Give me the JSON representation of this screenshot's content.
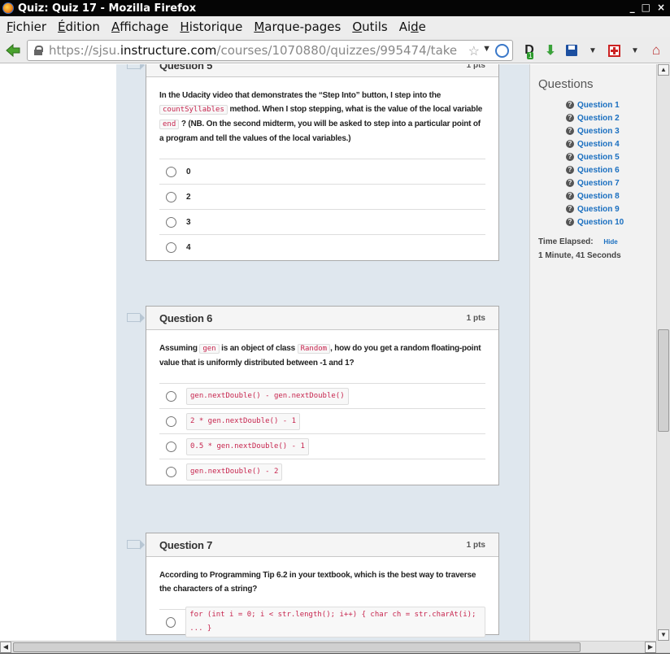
{
  "window": {
    "title": "Quiz: Quiz 17 - Mozilla Firefox",
    "controls": [
      "_",
      "□",
      "×"
    ]
  },
  "menu": [
    {
      "pre": "",
      "key": "F",
      "post": "ichier"
    },
    {
      "pre": "",
      "key": "É",
      "post": "dition"
    },
    {
      "pre": "",
      "key": "A",
      "post": "ffichage"
    },
    {
      "pre": "",
      "key": "H",
      "post": "istorique"
    },
    {
      "pre": "",
      "key": "M",
      "post": "arque-pages"
    },
    {
      "pre": "",
      "key": "O",
      "post": "utils"
    },
    {
      "pre": "Ai",
      "key": "d",
      "post": "e"
    }
  ],
  "urlbar": {
    "prefix": "https://sjsu.",
    "domain": "instructure.com",
    "path": "/courses/1070880/quizzes/995474/take"
  },
  "toolbar": {
    "d_badge": "1"
  },
  "questions": [
    {
      "name": "Question 5",
      "points": "1 pts",
      "text": [
        {
          "t": "In the Udacity video that demonstrates the “Step Into” button, I step into the "
        },
        {
          "c": "countSyllables"
        },
        {
          "t": " method. When I stop stepping, what is the value of the local variable "
        },
        {
          "c": "end"
        },
        {
          "t": " ? (NB. On the second midterm, you will be asked to step into a particular point of a program and tell the values of the local variables.)"
        }
      ],
      "answers": [
        {
          "label": "0",
          "code": false
        },
        {
          "label": "2",
          "code": false
        },
        {
          "label": "3",
          "code": false
        },
        {
          "label": "4",
          "code": false
        }
      ]
    },
    {
      "name": "Question 6",
      "points": "1 pts",
      "text": [
        {
          "t": "Assuming "
        },
        {
          "c": "gen"
        },
        {
          "t": " is an object of class "
        },
        {
          "c": "Random"
        },
        {
          "t": ", how do you get a random floating-point value that is uniformly distributed between -1 and 1?"
        }
      ],
      "answers": [
        {
          "label": "gen.nextDouble() - gen.nextDouble()",
          "code": true
        },
        {
          "label": "2 * gen.nextDouble() - 1",
          "code": true
        },
        {
          "label": "0.5 * gen.nextDouble() - 1",
          "code": true
        },
        {
          "label": "gen.nextDouble() - 2",
          "code": true
        }
      ]
    },
    {
      "name": "Question 7",
      "points": "1 pts",
      "text": [
        {
          "t": "According to Programming Tip 6.2 in your textbook, which is the best way to traverse the characters of a string?"
        }
      ],
      "answers": [
        {
          "label": "for (int i = 0; i < str.length(); i++) { char ch = str.charAt(i); ... }",
          "code": true
        }
      ]
    }
  ],
  "sidebar": {
    "title": "Questions",
    "links": [
      "Question 1",
      "Question 2",
      "Question 3",
      "Question 4",
      "Question 5",
      "Question 6",
      "Question 7",
      "Question 8",
      "Question 9",
      "Question 10"
    ],
    "elapsed_label": "Time Elapsed:",
    "hide_label": "Hide",
    "elapsed_value": "1 Minute, 41 Seconds"
  }
}
